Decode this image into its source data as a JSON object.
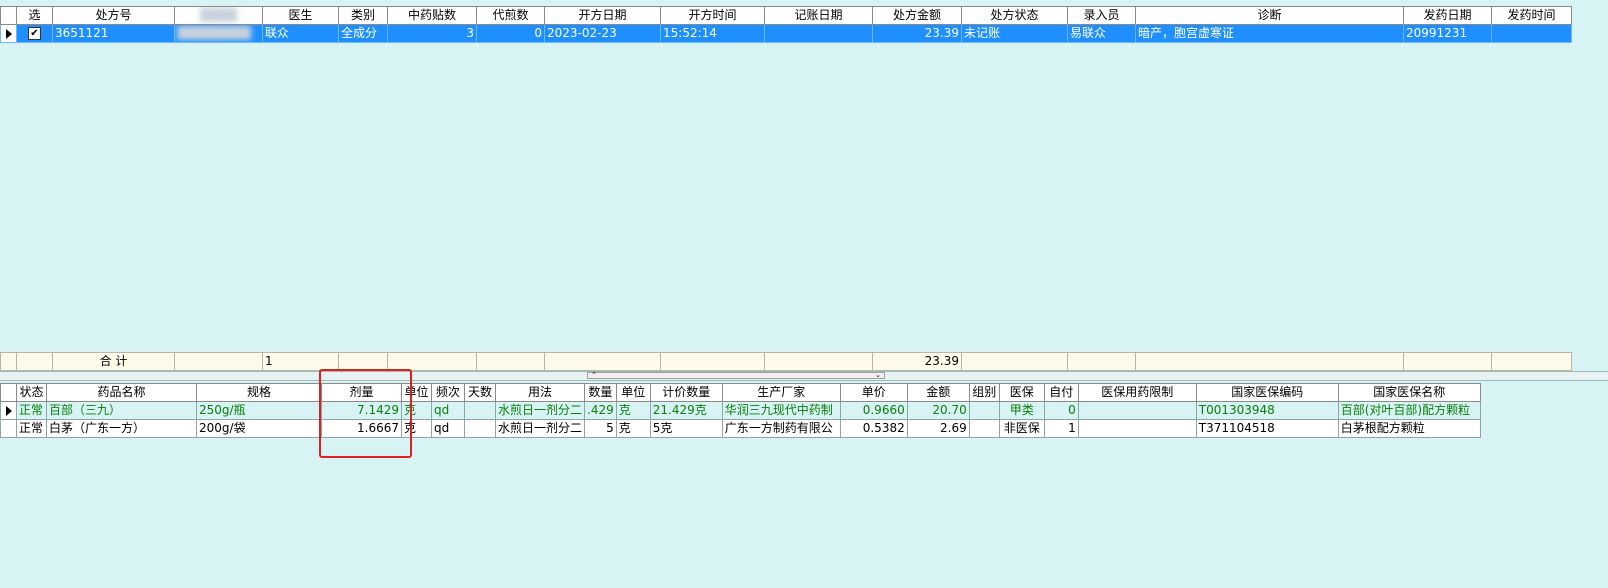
{
  "prescription_grid": {
    "columns": [
      "选",
      "处方号",
      "",
      "医生",
      "类别",
      "中药贴数",
      "代煎数",
      "开方日期",
      "开方时间",
      "记账日期",
      "处方金额",
      "处方状态",
      "录入员",
      "诊断",
      "发药日期",
      "发药时间"
    ],
    "rows": [
      {
        "checked": true,
        "rx_no": "3651121",
        "blurred": "",
        "doctor": "联众",
        "category": "全成分",
        "herb_doses": "3",
        "decoct_count": "0",
        "rx_date": "2023-02-23",
        "rx_time": "15:52:14",
        "bill_date": "",
        "amount": "23.39",
        "status": "未记账",
        "operator": "易联众",
        "diagnosis": "暗产，胞宫虚寒证",
        "dispense_date": "20991231",
        "dispense_time": ""
      }
    ],
    "summary": {
      "label": "合  计",
      "herb_doses": "1",
      "amount": "23.39"
    }
  },
  "splitter": {
    "up_arrow": "⌃",
    "down_arrow": "⌄"
  },
  "drug_grid": {
    "columns": [
      "状态",
      "药品名称",
      "规格",
      "剂量",
      "单位",
      "频次",
      "天数",
      "用法",
      "数量",
      "单位",
      "计价数量",
      "生产厂家",
      "单价",
      "金额",
      "组别",
      "医保",
      "自付",
      "医保用药限制",
      "国家医保编码",
      "国家医保名称"
    ],
    "rows": [
      {
        "status": "正常",
        "name": "百部（三九）",
        "spec": "250g/瓶",
        "dose": "7.1429",
        "unit": "克",
        "freq": "qd",
        "days": "",
        "usage": "水煎日一剂分二",
        "qty": ".429",
        "qty_unit": "克",
        "bill_qty": "21.429克",
        "maker": "华润三九现代中药制",
        "price": "0.9660",
        "total": "20.70",
        "group": "",
        "insurance": "甲类",
        "self_pay": "0",
        "limit": "",
        "nat_code": "T001303948",
        "nat_name": "百部(对叶百部)配方颗粒",
        "green": true
      },
      {
        "status": "正常",
        "name": "白茅（广东一方）",
        "spec": "200g/袋",
        "dose": "1.6667",
        "unit": "克",
        "freq": "qd",
        "days": "",
        "usage": "水煎日一剂分二",
        "qty": "5",
        "qty_unit": "克",
        "bill_qty": "5克",
        "maker": "广东一方制药有限公",
        "price": "0.5382",
        "total": "2.69",
        "group": "",
        "insurance": "非医保",
        "self_pay": "1",
        "limit": "",
        "nat_code": "T371104518",
        "nat_name": "白茅根配方颗粒",
        "green": false
      }
    ]
  },
  "colors": {
    "background": "#d7f3f3",
    "selected_row": "#1f8fff",
    "highlight_box": "#e02020",
    "green_text": "#0a7f0a"
  }
}
